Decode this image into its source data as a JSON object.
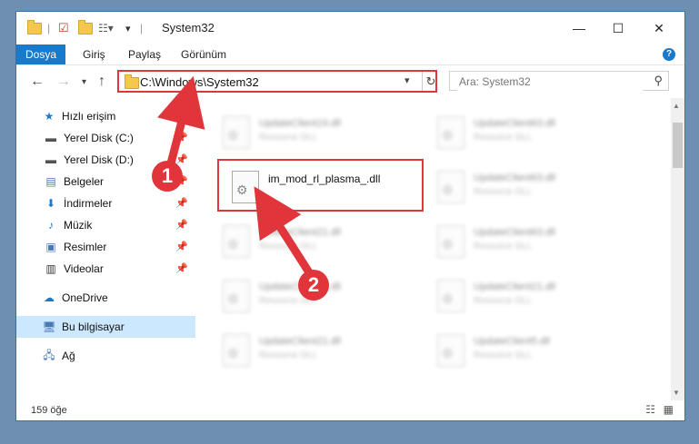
{
  "titlebar": {
    "title": "System32",
    "minimize": "—",
    "maximize": "☐",
    "close": "✕"
  },
  "ribbon": {
    "tabs": [
      "Dosya",
      "Giriş",
      "Paylaş",
      "Görünüm"
    ],
    "help": "?"
  },
  "address": {
    "path": "C:\\Windows\\System32",
    "search_placeholder": "Ara: System32"
  },
  "sidebar": {
    "quick_access": "Hızlı erişim",
    "items": [
      {
        "label": "Yerel Disk (C:)"
      },
      {
        "label": "Yerel Disk (D:)"
      },
      {
        "label": "Belgeler"
      },
      {
        "label": "İndirmeler"
      },
      {
        "label": "Müzik"
      },
      {
        "label": "Resimler"
      },
      {
        "label": "Videolar"
      }
    ],
    "onedrive": "OneDrive",
    "this_pc": "Bu bilgisayar",
    "network": "Ağ"
  },
  "files": {
    "highlighted": "im_mod_rl_plasma_.dll",
    "left": [
      {
        "name": "UpdateClient19.dll",
        "type": "Resource DLL"
      },
      {
        "name": "UpdateClient21.dll",
        "type": "Resource DLL"
      },
      {
        "name": "UpdateClient65.dll",
        "type": "Resource DLL"
      },
      {
        "name": "UpdateClient21.dll",
        "type": "Resource DLL"
      }
    ],
    "right": [
      {
        "name": "UpdateClient63.dll",
        "type": "Resource DLL"
      },
      {
        "name": "UpdateClient63.dll",
        "type": "Resource DLL"
      },
      {
        "name": "UpdateClient63.dll",
        "type": "Resource DLL"
      },
      {
        "name": "UpdateClient21.dll",
        "type": "Resource DLL"
      },
      {
        "name": "UpdateClient5.dll",
        "type": "Resource DLL"
      }
    ]
  },
  "status": {
    "count": "159 öğe"
  },
  "annotations": {
    "step1": "1",
    "step2": "2"
  },
  "colors": {
    "accent": "#1979ca",
    "annotation_red": "#e0353a"
  }
}
